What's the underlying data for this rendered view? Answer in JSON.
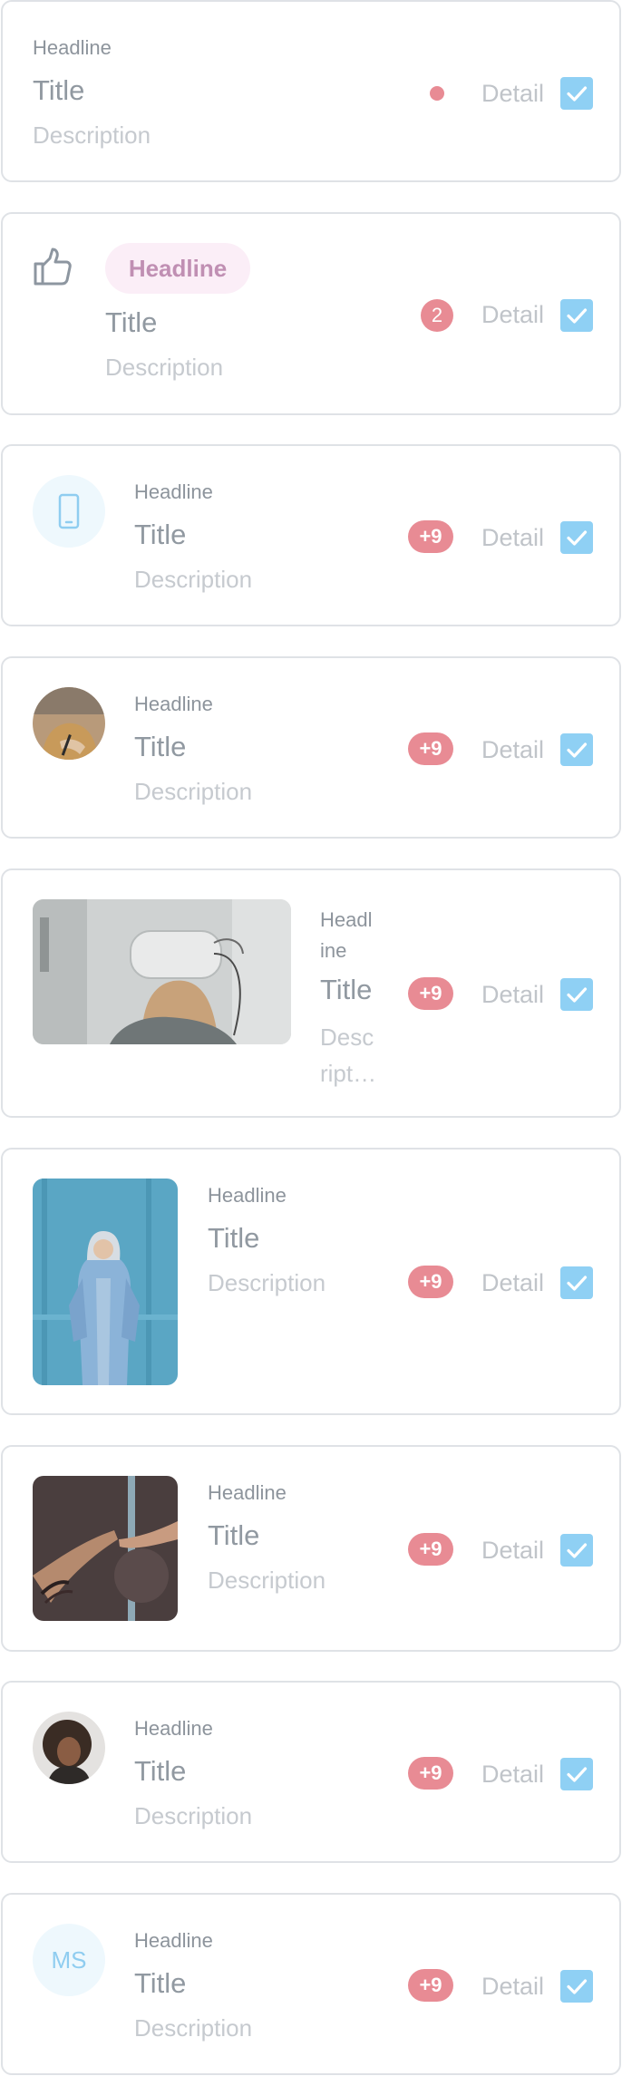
{
  "colors": {
    "badge_red": "#e88b94",
    "checkbox_blue": "#8fd0f4",
    "border": "#dfe2e6",
    "chip_bg": "#fbeef7",
    "chip_text": "#c08fb3"
  },
  "cards": [
    {
      "leading": "none",
      "headline": "Headline",
      "title": "Title",
      "description": "Description",
      "badge": "",
      "detail": "Detail",
      "checked": true
    },
    {
      "leading": "thumbs-up-icon",
      "headline": "Headline",
      "title": "Title",
      "description": "Description",
      "badge": "2",
      "detail": "Detail",
      "checked": true
    },
    {
      "leading": "phone-icon",
      "headline": "Headline",
      "title": "Title",
      "description": "Description",
      "badge": "+9",
      "detail": "Detail",
      "checked": true
    },
    {
      "leading": "avatar-photo",
      "headline": "Headline",
      "title": "Title",
      "description": "Description",
      "badge": "+9",
      "detail": "Detail",
      "checked": true
    },
    {
      "leading": "wide-photo",
      "headline": "Headline",
      "title": "Title",
      "description": "Description",
      "badge": "+9",
      "detail": "Detail",
      "checked": true
    },
    {
      "leading": "tall-photo",
      "headline": "Headline",
      "title": "Title",
      "description": "Description",
      "badge": "+9",
      "detail": "Detail",
      "checked": true
    },
    {
      "leading": "square-photo",
      "headline": "Headline",
      "title": "Title",
      "description": "Description",
      "badge": "+9",
      "detail": "Detail",
      "checked": true
    },
    {
      "leading": "avatar-photo",
      "headline": "Headline",
      "title": "Title",
      "description": "Description",
      "badge": "+9",
      "detail": "Detail",
      "checked": true
    },
    {
      "leading": "initials-avatar",
      "initials": "MS",
      "headline": "Headline",
      "title": "Title",
      "description": "Description",
      "badge": "+9",
      "detail": "Detail",
      "checked": true
    }
  ]
}
